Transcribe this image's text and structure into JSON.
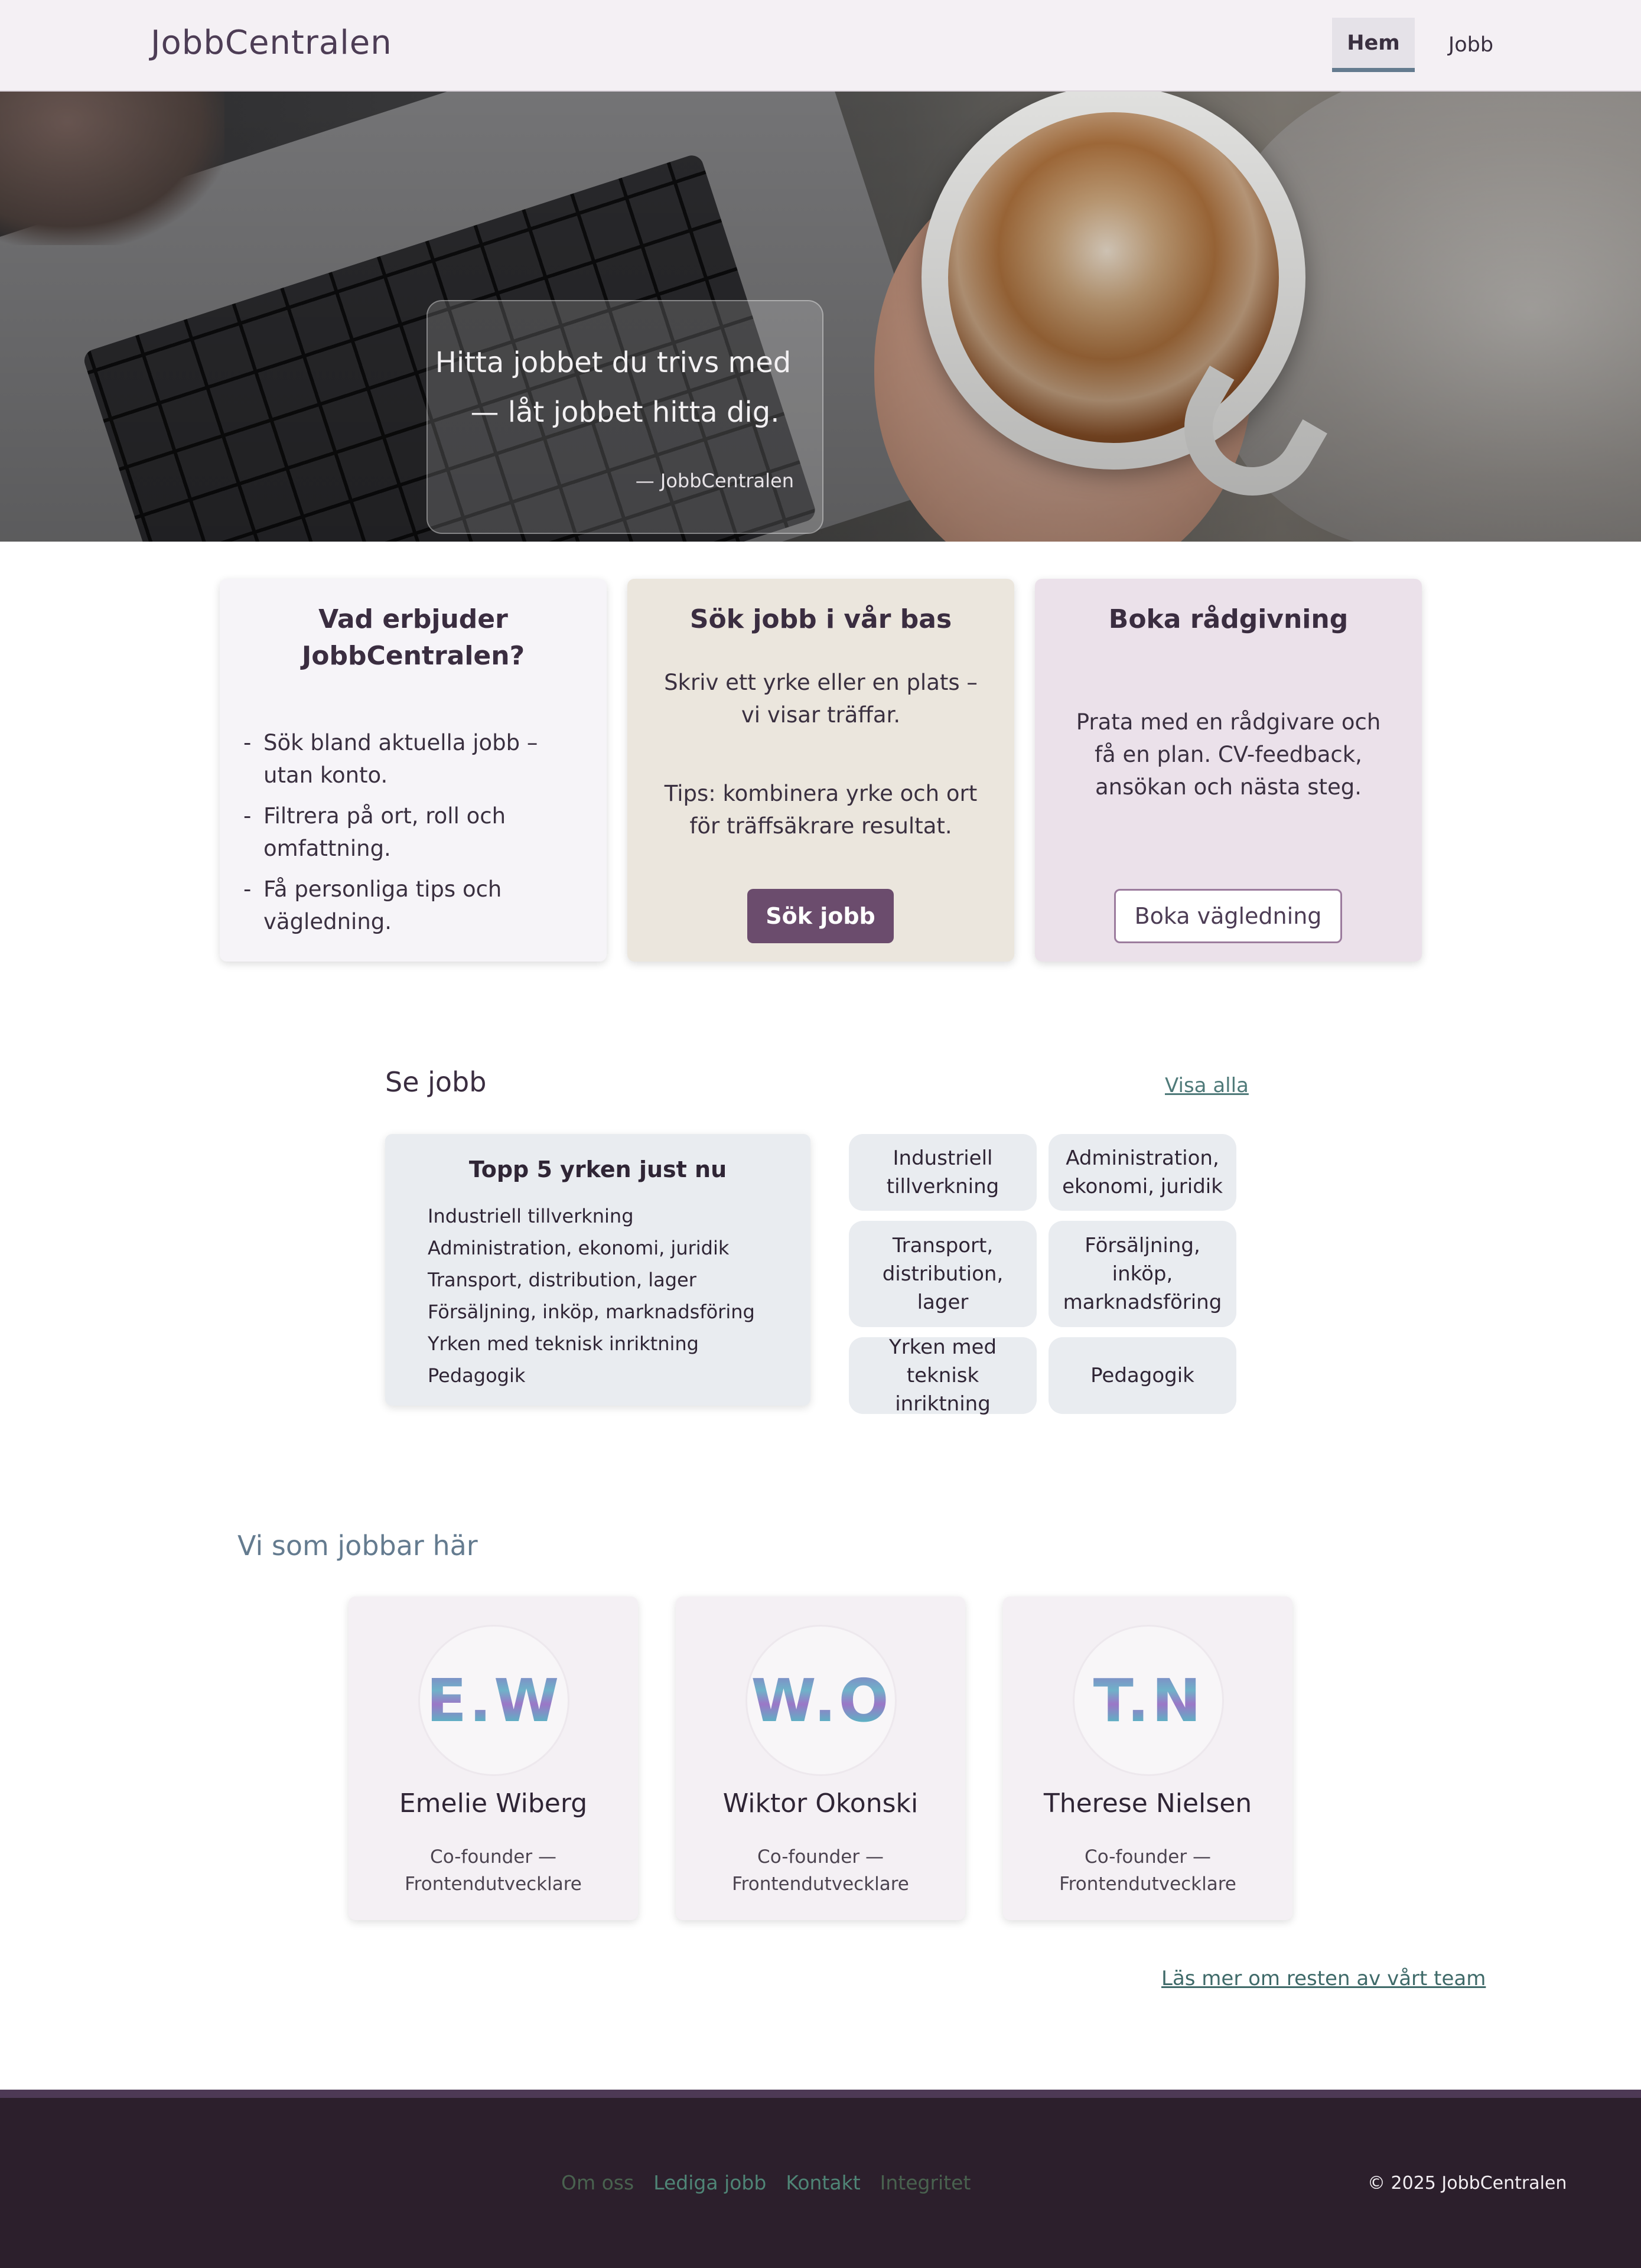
{
  "nav": {
    "logo": "JobbCentralen",
    "items": [
      {
        "label": "Hem",
        "active": true
      },
      {
        "label": "Jobb",
        "active": false
      }
    ]
  },
  "hero": {
    "quote_line1": "Hitta jobbet du trivs med",
    "quote_line2": "— låt jobbet hitta dig.",
    "quote_author": "— JobbCentralen"
  },
  "cards": {
    "offer": {
      "title": "Vad erbjuder JobbCentralen?",
      "bullets": [
        "Sök bland aktuella jobb – utan konto.",
        "Filtrera på ort, roll och omfattning.",
        "Få personliga tips och vägledning."
      ]
    },
    "search": {
      "title": "Sök jobb i vår bas",
      "text": "Skriv ett yrke eller en plats – vi visar träffar.",
      "tip": "Tips: kombinera yrke och ort för träffsäkrare resultat.",
      "button": "Sök jobb"
    },
    "advice": {
      "title": "Boka rådgivning",
      "text": "Prata med en rådgivare och få en plan. CV-feedback, ansökan och nästa steg.",
      "button": "Boka vägledning"
    }
  },
  "jobs": {
    "title": "Se jobb",
    "view_all": "Visa alla",
    "top5_title": "Topp 5 yrken just nu",
    "top5_list": [
      "Industriell tillverkning",
      "Administration, ekonomi, juridik",
      "Transport, distribution, lager",
      "Försäljning, inköp, marknadsföring",
      "Yrken med teknisk inriktning",
      "Pedagogik"
    ],
    "tiles": [
      "Industriell tillverkning",
      "Administration, ekonomi, juridik",
      "Transport, distribution, lager",
      "Försäljning, inköp, marknadsföring",
      "Yrken med teknisk inriktning",
      "Pedagogik"
    ]
  },
  "team": {
    "title": "Vi som jobbar här",
    "members": [
      {
        "initials": "E.W",
        "name": "Emelie Wiberg",
        "role": "Co-founder — Frontendutvecklare"
      },
      {
        "initials": "W.O",
        "name": "Wiktor Okonski",
        "role": "Co-founder — Frontendutvecklare"
      },
      {
        "initials": "T.N",
        "name": "Therese Nielsen",
        "role": "Co-founder — Frontendutvecklare"
      }
    ],
    "more_link": "Läs mer om resten av vårt team"
  },
  "footer": {
    "links": [
      "Om oss",
      "Lediga jobb",
      "Kontakt",
      "Integritet"
    ],
    "copyright": "© 2025 JobbCentralen"
  },
  "colors": {
    "primary": "#6b4c6d",
    "accent_blue": "#647b8f",
    "link_green": "#4f7a79",
    "footer_bg": "#2c1f2c"
  }
}
